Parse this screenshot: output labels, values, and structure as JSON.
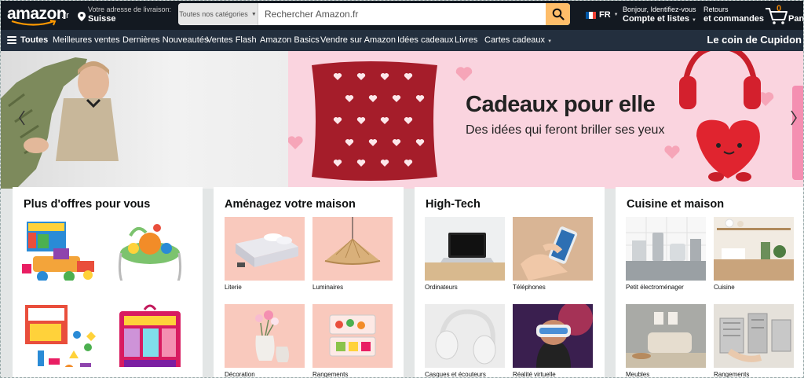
{
  "header": {
    "logo_text": "amazon",
    "logo_tld": ".fr",
    "delivery_line1": "Votre adresse de livraison:",
    "delivery_line2": "Suisse",
    "search_category": "Toutes nos catégories",
    "search_placeholder": "Rechercher Amazon.fr",
    "language": "FR",
    "account_line1": "Bonjour, Identifiez-vous",
    "account_line2": "Compte et listes",
    "orders_line1": "Retours",
    "orders_line2": "et commandes",
    "cart_count": "0",
    "cart_label": "Panier"
  },
  "nav": {
    "all_label": "Toutes",
    "links": [
      "Meilleures ventes",
      "Dernières Nouveautés",
      "Ventes Flash",
      "Amazon Basics",
      "Vendre sur Amazon",
      "Idées cadeaux",
      "Livres",
      "Cartes cadeaux"
    ],
    "promo": "Le coin de Cupidon"
  },
  "hero": {
    "title": "Cadeaux pour elle",
    "subtitle": "Des idées qui feront briller ses yeux"
  },
  "cards": [
    {
      "title": "Plus d'offres pour vous",
      "items": [
        "",
        "",
        "",
        ""
      ]
    },
    {
      "title": "Aménagez votre maison",
      "items": [
        "Literie",
        "Luminaires",
        "Décoration",
        "Rangements"
      ]
    },
    {
      "title": "High-Tech",
      "items": [
        "Ordinateurs",
        "Téléphones",
        "Casques et écouteurs",
        "Réalité virtuelle"
      ]
    },
    {
      "title": "Cuisine et maison",
      "items": [
        "Petit électroménager",
        "Cuisine",
        "Meubles",
        "Rangements"
      ]
    }
  ],
  "colors": {
    "header_bg": "#131921",
    "nav_bg": "#232f3e",
    "search_button": "#febd69",
    "hero_pink": "#fad4df",
    "cart_count": "#f08804"
  }
}
